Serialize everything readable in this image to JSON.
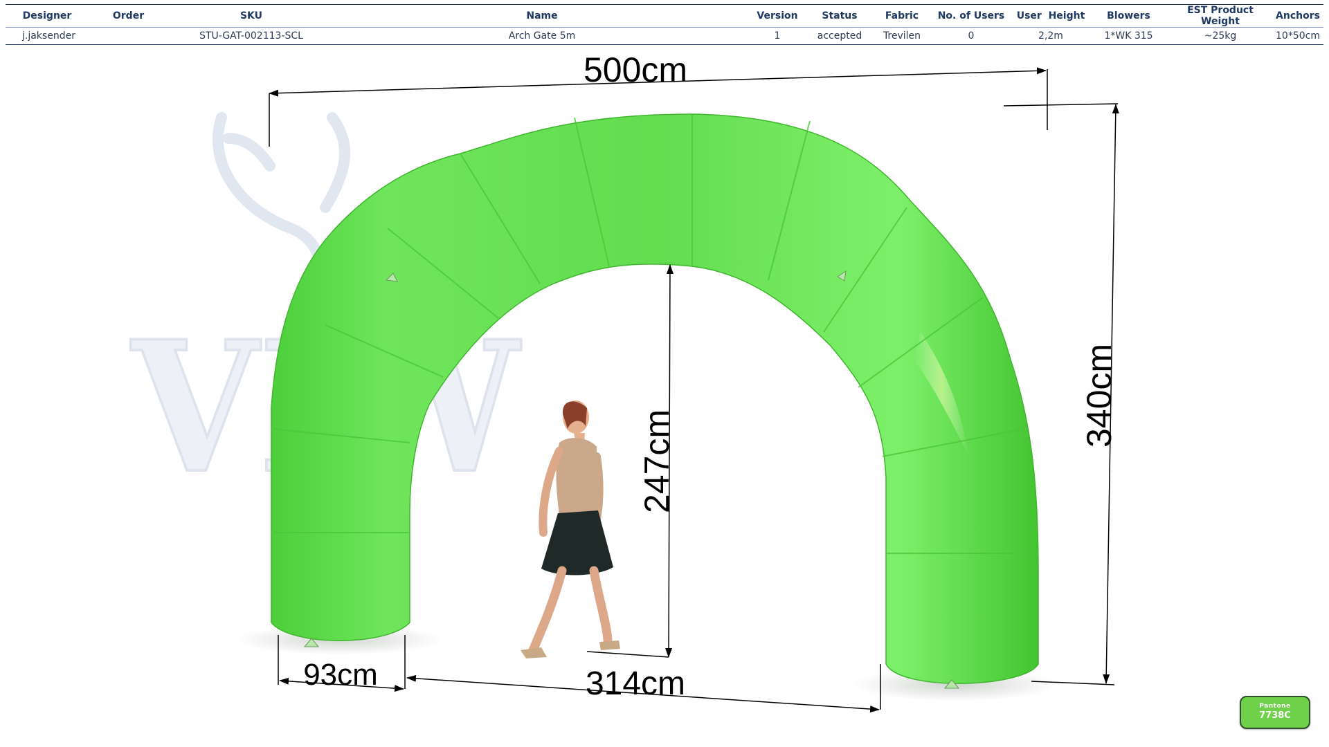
{
  "spec_table": {
    "headers": [
      "Designer",
      "Order",
      "SKU",
      "Name",
      "Version",
      "Status",
      "Fabric",
      "No. of Users",
      "User  Height",
      "Blowers",
      "EST Product Weight",
      "Anchors"
    ],
    "row": [
      "j.jaksender",
      "",
      "STU-GAT-002113-SCL",
      "Arch Gate 5m",
      "1",
      "accepted",
      "Trevilen",
      "0",
      "2,2m",
      "1*WK 315",
      "~25kg",
      "10*50cm"
    ]
  },
  "dimensions": {
    "width": "500cm",
    "height": "340cm",
    "inner_height": "247cm",
    "inner_width": "314cm",
    "leg_diameter": "93cm"
  },
  "watermark": {
    "text": "VIW"
  },
  "pantone": {
    "brand": "Pantone",
    "code": "7738C"
  },
  "colors": {
    "arch": "#6ee05a",
    "header_text": "#1f3864",
    "dimension_line": "#000000"
  }
}
